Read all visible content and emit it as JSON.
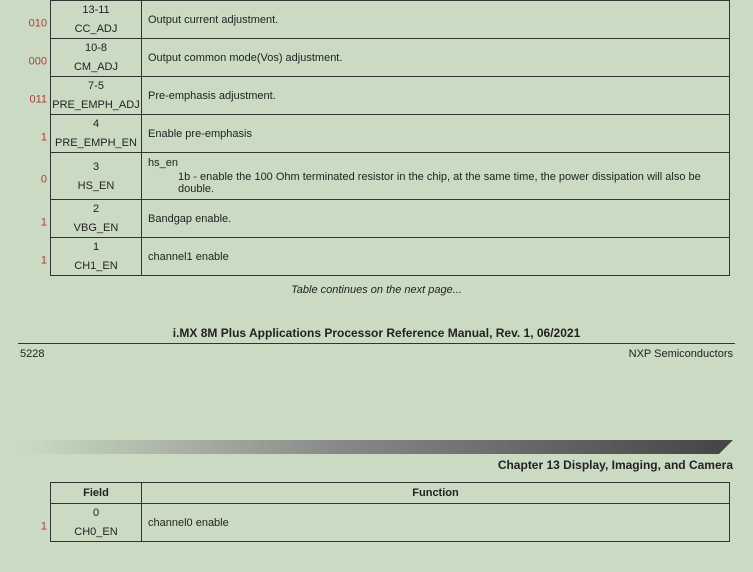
{
  "rows1": [
    {
      "reset": "010",
      "bits": "13-11",
      "field": "CC_ADJ",
      "func": "Output current adjustment."
    },
    {
      "reset": "000",
      "bits": "10-8",
      "field": "CM_ADJ",
      "func": "Output common mode(Vos) adjustment."
    },
    {
      "reset": "011",
      "bits": "7-5",
      "field": "PRE_EMPH_ADJ",
      "func": "Pre-emphasis adjustment."
    },
    {
      "reset": "1",
      "bits": "4",
      "field": "PRE_EMPH_EN",
      "func": "Enable pre-emphasis"
    },
    {
      "reset": "0",
      "bits": "3",
      "field": "HS_EN",
      "func": "hs_en",
      "sub": "1b - enable the 100 Ohm terminated resistor in the chip, at the same time, the power dissipation will also be double."
    },
    {
      "reset": "1",
      "bits": "2",
      "field": "VBG_EN",
      "func": "Bandgap enable."
    },
    {
      "reset": "1",
      "bits": "1",
      "field": "CH1_EN",
      "func": "channel1 enable"
    }
  ],
  "table_continues": "Table continues on the next page...",
  "doc_title": "i.MX 8M Plus Applications Processor Reference Manual, Rev. 1, 06/2021",
  "page_number": "5228",
  "company": "NXP Semiconductors",
  "chapter": "Chapter 13 Display, Imaging, and Camera",
  "header2": {
    "field": "Field",
    "func": "Function"
  },
  "rows2": [
    {
      "reset": "1",
      "bits": "0",
      "field": "CH0_EN",
      "func": "channel0 enable"
    }
  ]
}
